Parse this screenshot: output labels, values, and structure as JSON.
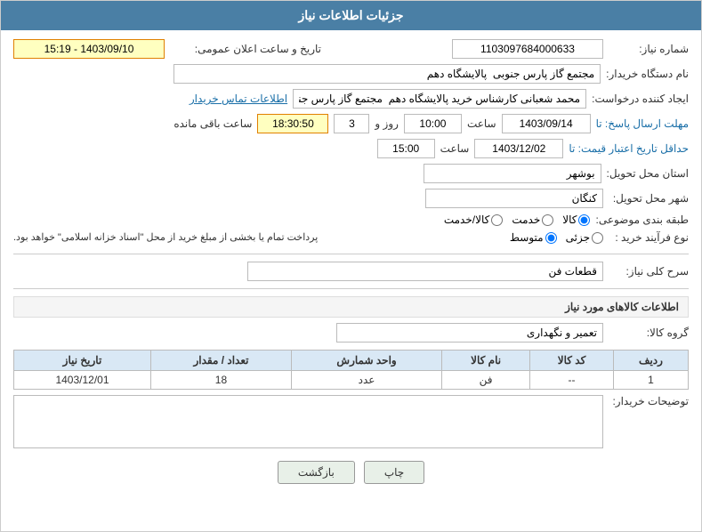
{
  "header": {
    "title": "جزئیات اطلاعات نیاز"
  },
  "form": {
    "shomara_niaz_label": "شماره نیاز:",
    "shomara_niaz_value": "1103097684000633",
    "nam_dastgah_label": "نام دستگاه خریدار:",
    "nam_dastgah_value": "مجتمع گاز پارس جنوبی  پالایشگاه دهم",
    "tarikh_label": "تاریخ و ساعت اعلان عمومی:",
    "tarikh_value": "1403/09/10 - 15:19",
    "creator_label": "ایجاد کننده درخواست:",
    "creator_value": "محمد شعبانی کارشناس خرید پالایشگاه دهم  مجتمع گاز پارس جنوبی  پالایشگاه",
    "contact_label": "اطلاعات تماس خریدار",
    "mohlat_label": "مهلت ارسال پاسخ: تا",
    "mohlat_date": "1403/09/14",
    "mohlat_time": "10:00",
    "mohlat_days": "3",
    "mohlat_remaining": "18:30:50",
    "mohlat_remaining_label": "ساعت باقی مانده",
    "jadval_label": "حداقل تاریخ اعتبار قیمت: تا",
    "jadval_date": "1403/12/02",
    "jadval_time": "15:00",
    "ostan_label": "استان محل تحویل:",
    "ostan_value": "بوشهر",
    "shahr_label": "شهر محل تحویل:",
    "shahr_value": "کنگان",
    "tabaqe_label": "طبقه بندی موضوعی:",
    "tabaqe_options": [
      {
        "label": "کالا",
        "value": "kala"
      },
      {
        "label": "خدمت",
        "value": "khedmat"
      },
      {
        "label": "کالا/خدمت",
        "value": "kala_khedmat"
      }
    ],
    "tabaqe_selected": "kala",
    "nooe_farayand_label": "نوع فرآیند خرید :",
    "nooe_options": [
      {
        "label": "جزئی",
        "value": "jozi"
      },
      {
        "label": "متوسط",
        "value": "mota"
      },
      {
        "label": "",
        "value": ""
      }
    ],
    "nooe_selected": "mota",
    "note_text": "پرداخت تمام یا بخشی از مبلغ خرید از محل \"اسناد خزانه اسلامی\" خواهد بود.",
    "sarh_label": "سرح کلی نیاز:",
    "sarh_value": "قطعات فن",
    "info_section_title": "اطلاعات کالاهای مورد نیاز",
    "group_label": "گروه کالا:",
    "group_value": "تعمیر و نگهداری",
    "table": {
      "headers": [
        "ردیف",
        "کد کالا",
        "نام کالا",
        "واحد شمارش",
        "تعداد / مقدار",
        "تاریخ نیاز"
      ],
      "rows": [
        {
          "radif": "1",
          "kod": "--",
          "name": "فن",
          "vahed": "عدد",
          "tedad": "18",
          "tarikh": "1403/12/01"
        }
      ]
    },
    "notes_label": "توضیحات خریدار:",
    "notes_value": "",
    "btn_print": "چاپ",
    "btn_back": "بازگشت"
  }
}
